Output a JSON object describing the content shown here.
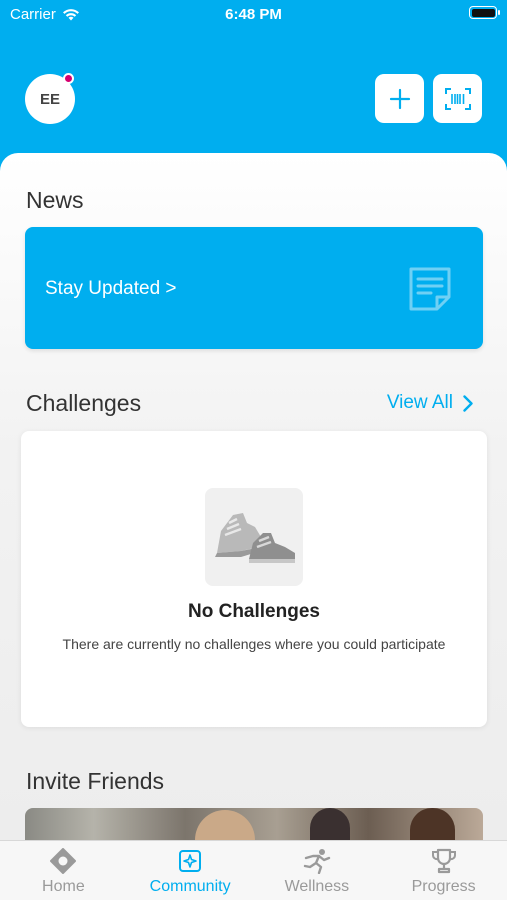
{
  "status_bar": {
    "carrier": "Carrier",
    "time": "6:48 PM"
  },
  "header": {
    "avatar_initials": "EE",
    "add_icon": "plus-icon",
    "scan_icon": "barcode-scan-icon"
  },
  "news": {
    "title": "News",
    "card_label": "Stay Updated >",
    "card_icon": "document-icon"
  },
  "challenges": {
    "title": "Challenges",
    "view_all": "View All",
    "empty_title": "No Challenges",
    "empty_description": "There are currently no challenges where you could participate",
    "empty_icon": "sneakers-icon"
  },
  "invite": {
    "title": "Invite Friends"
  },
  "tabs": [
    {
      "label": "Home",
      "icon": "home-icon",
      "active": false
    },
    {
      "label": "Community",
      "icon": "community-icon",
      "active": true
    },
    {
      "label": "Wellness",
      "icon": "runner-icon",
      "active": false
    },
    {
      "label": "Progress",
      "icon": "trophy-icon",
      "active": false
    }
  ],
  "colors": {
    "accent": "#00aeef",
    "notification": "#d6006f",
    "inactive_tab": "#9a9a9a"
  }
}
